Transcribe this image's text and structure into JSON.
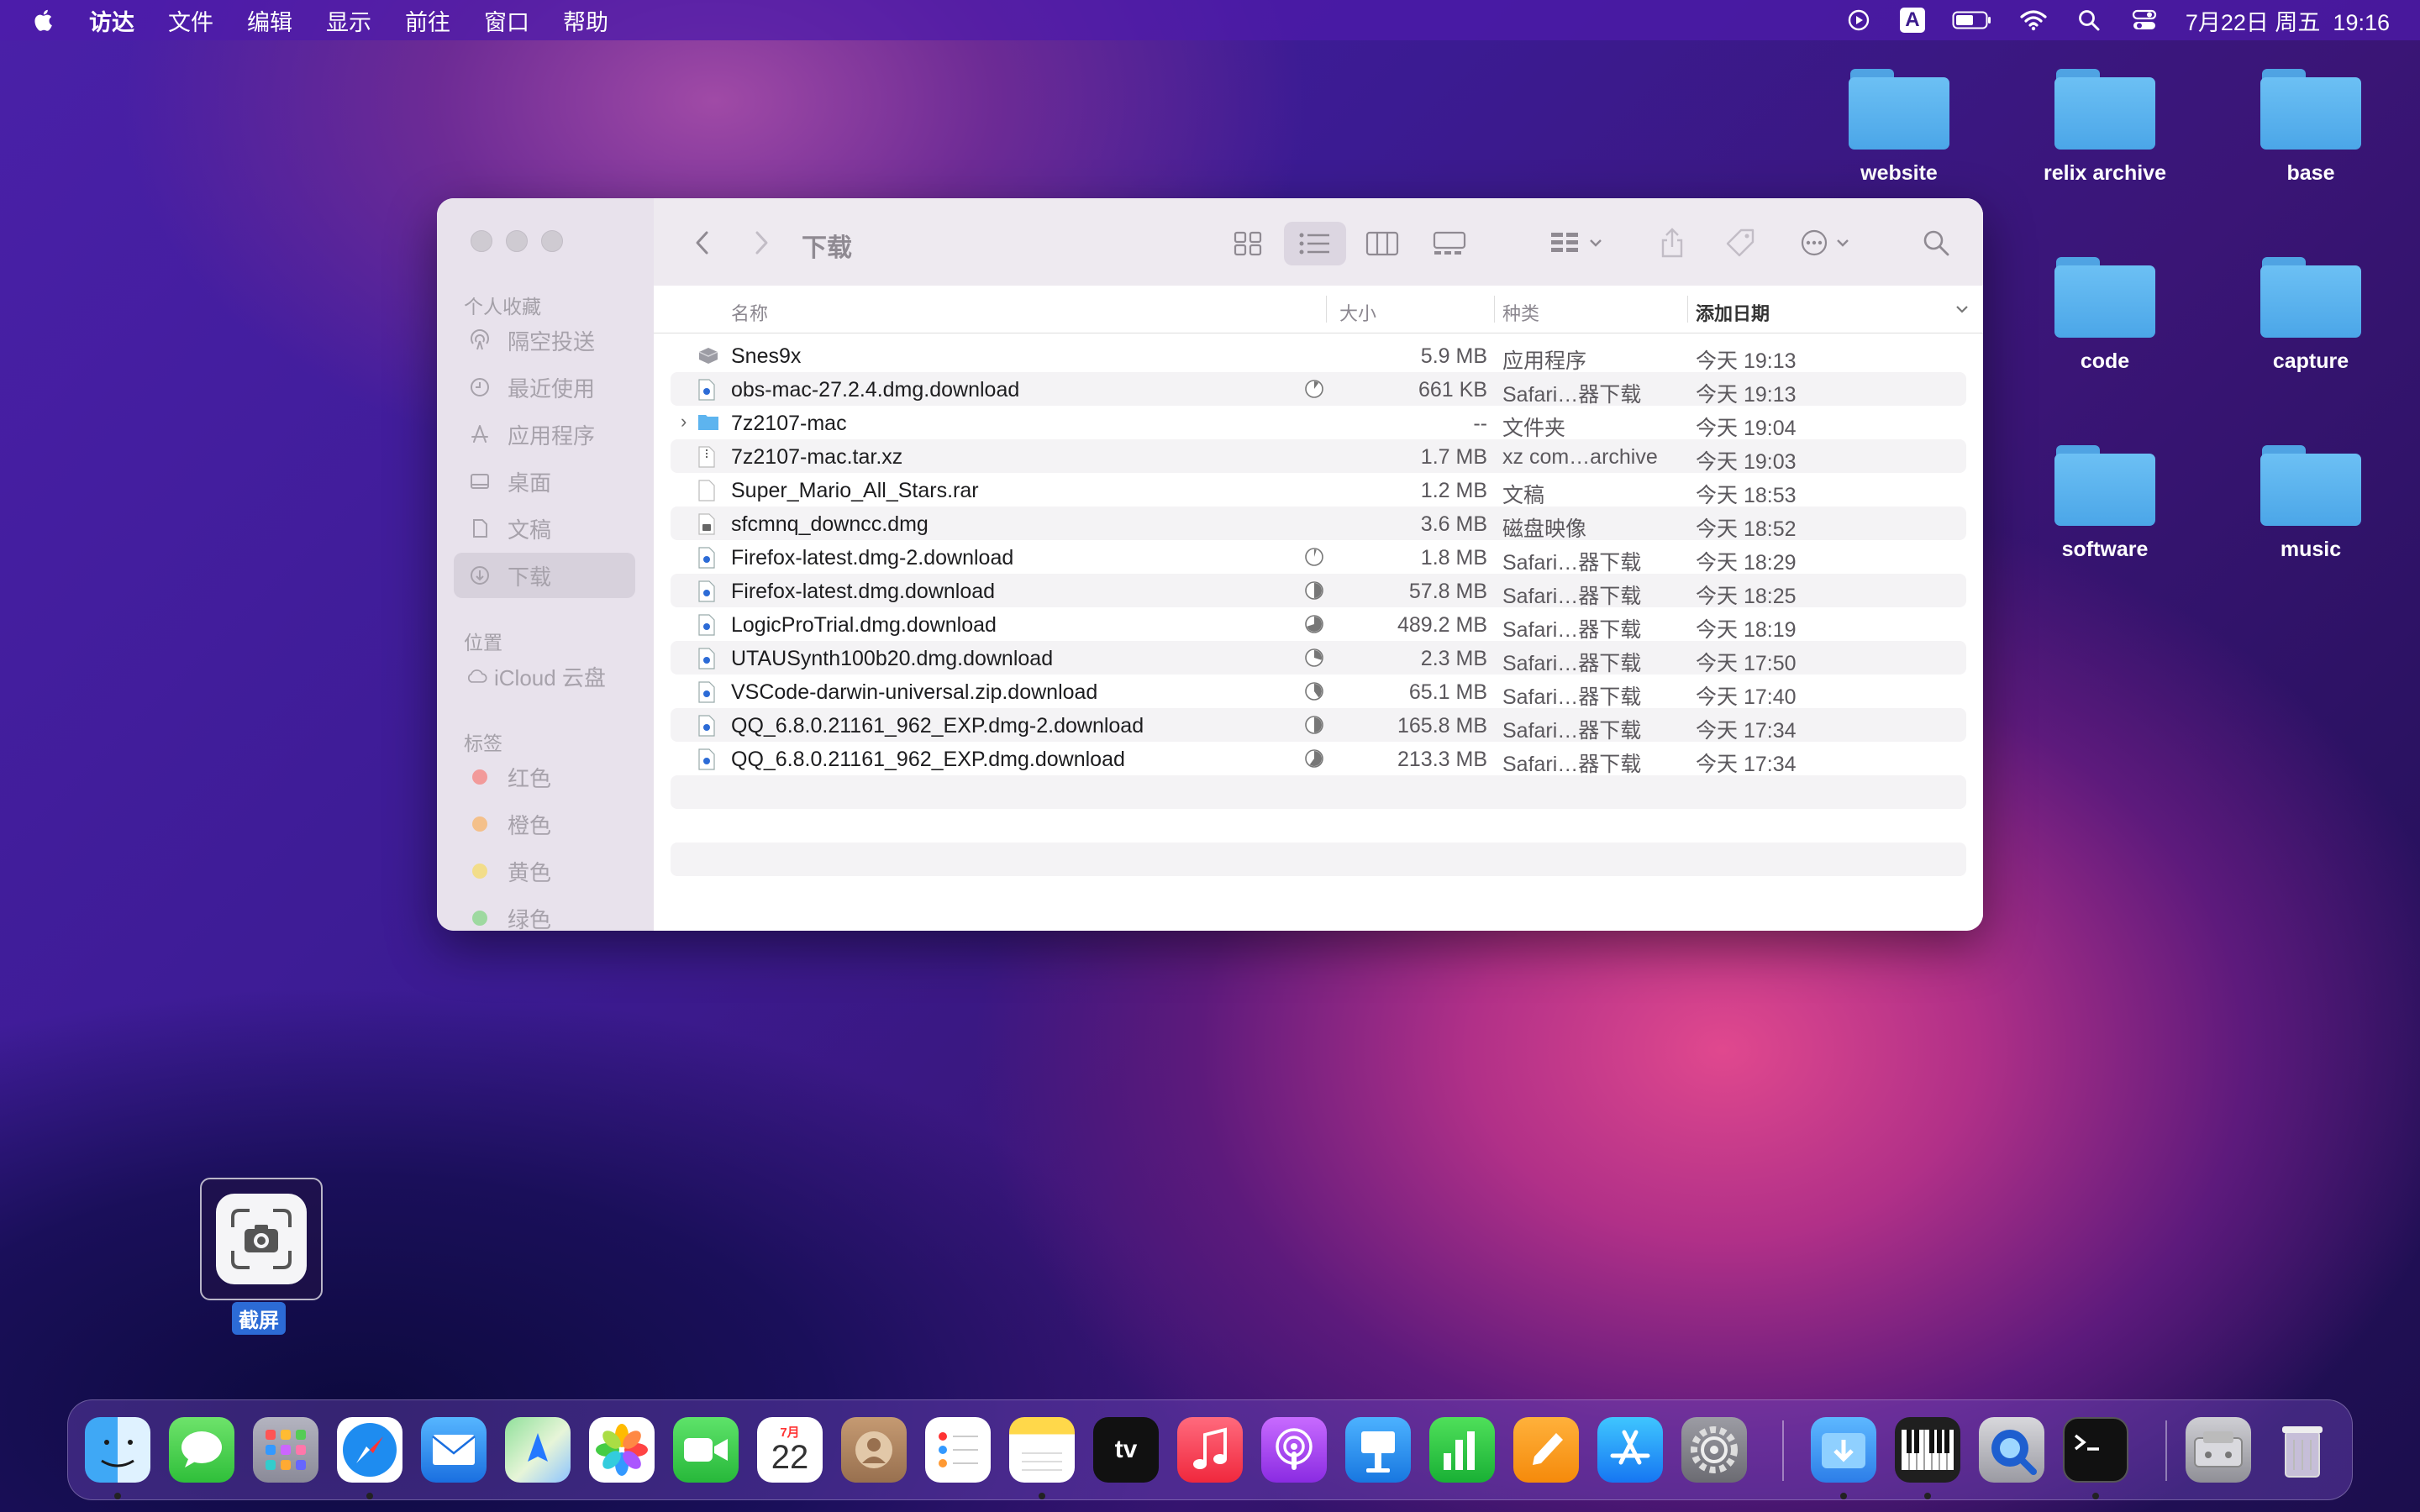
{
  "menubar": {
    "apple_label": "",
    "items": [
      "访达",
      "文件",
      "编辑",
      "显示",
      "前往",
      "窗口",
      "帮助"
    ],
    "input_method": "A",
    "datetime": "7月22日 周五  19:16"
  },
  "desktop": {
    "folders": [
      "website",
      "relix archive",
      "base",
      "code",
      "capture",
      "software",
      "music"
    ]
  },
  "finder": {
    "title": "下载",
    "sidebar": {
      "favorites_header": "个人收藏",
      "favorites": [
        "隔空投送",
        "最近使用",
        "应用程序",
        "桌面",
        "文稿",
        "下载"
      ],
      "locations_header": "位置",
      "locations": [
        "iCloud 云盘"
      ],
      "tags_header": "标签",
      "tags": [
        {
          "label": "红色",
          "color": "#f29a9a"
        },
        {
          "label": "橙色",
          "color": "#f4c08a"
        },
        {
          "label": "黄色",
          "color": "#f2dd8a"
        },
        {
          "label": "绿色",
          "color": "#9ed9a0"
        }
      ]
    },
    "columns": {
      "name": "名称",
      "size": "大小",
      "kind": "种类",
      "date": "添加日期"
    },
    "files": [
      {
        "name": "Snes9x",
        "size": "5.9 MB",
        "kind": "应用程序",
        "date": "今天 19:13",
        "icon": "app-icon"
      },
      {
        "name": "obs-mac-27.2.4.dmg.download",
        "size": "661 KB",
        "kind": "Safari…器下载",
        "date": "今天 19:13",
        "icon": "download-icon",
        "progress": 0.1
      },
      {
        "name": "7z2107-mac",
        "size": "--",
        "kind": "文件夹",
        "date": "今天 19:04",
        "icon": "folder-icon"
      },
      {
        "name": "7z2107-mac.tar.xz",
        "size": "1.7 MB",
        "kind": "xz com…archive",
        "date": "今天 19:03",
        "icon": "archive-icon"
      },
      {
        "name": "Super_Mario_All_Stars.rar",
        "size": "1.2 MB",
        "kind": "文稿",
        "date": "今天 18:53",
        "icon": "document-icon"
      },
      {
        "name": "sfcmnq_downcc.dmg",
        "size": "3.6 MB",
        "kind": "磁盘映像",
        "date": "今天 18:52",
        "icon": "disk-image-icon"
      },
      {
        "name": "Firefox-latest.dmg-2.download",
        "size": "1.8 MB",
        "kind": "Safari…器下载",
        "date": "今天 18:29",
        "icon": "download-icon",
        "progress": 0.05
      },
      {
        "name": "Firefox-latest.dmg.download",
        "size": "57.8 MB",
        "kind": "Safari…器下载",
        "date": "今天 18:25",
        "icon": "download-icon",
        "progress": 0.5
      },
      {
        "name": "LogicProTrial.dmg.download",
        "size": "489.2 MB",
        "kind": "Safari…器下载",
        "date": "今天 18:19",
        "icon": "download-icon",
        "progress": 0.7
      },
      {
        "name": "UTAUSynth100b20.dmg.download",
        "size": "2.3 MB",
        "kind": "Safari…器下载",
        "date": "今天 17:50",
        "icon": "download-icon",
        "progress": 0.3
      },
      {
        "name": "VSCode-darwin-universal.zip.download",
        "size": "65.1 MB",
        "kind": "Safari…器下载",
        "date": "今天 17:40",
        "icon": "download-icon",
        "progress": 0.4
      },
      {
        "name": "QQ_6.8.0.21161_962_EXP.dmg-2.download",
        "size": "165.8 MB",
        "kind": "Safari…器下载",
        "date": "今天 17:34",
        "icon": "download-icon",
        "progress": 0.5
      },
      {
        "name": "QQ_6.8.0.21161_962_EXP.dmg.download",
        "size": "213.3 MB",
        "kind": "Safari…器下载",
        "date": "今天 17:34",
        "icon": "download-icon",
        "progress": 0.6
      }
    ]
  },
  "screenshot_thumb": {
    "label": "截屏"
  },
  "dock": {
    "calendar_month": "7月",
    "calendar_day": "22",
    "tv_label": "tv"
  },
  "colors": {
    "accent": "#2c6bd6",
    "folder": "#5db4ef"
  }
}
